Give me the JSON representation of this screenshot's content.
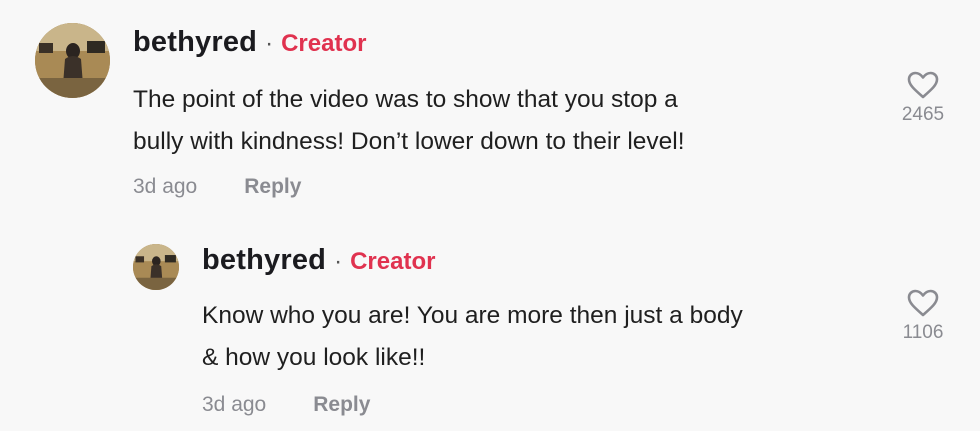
{
  "comments": [
    {
      "username": "bethyred",
      "separator": "·",
      "badge": "Creator",
      "text_lines": [
        "The point of the video was to show that you stop a",
        "bully with kindness! Don’t lower down to their level!"
      ],
      "time": "3d ago",
      "reply_label": "Reply",
      "like_count": "2465"
    },
    {
      "username": "bethyred",
      "separator": "·",
      "badge": "Creator",
      "text_lines": [
        "Know who you are! You are more then just a body",
        "& how you look like!!"
      ],
      "time": "3d ago",
      "reply_label": "Reply",
      "like_count": "1106"
    }
  ],
  "icons": {
    "like": "heart-outline-icon",
    "avatar": "user-avatar"
  },
  "colors": {
    "background": "#f8f8f8",
    "creator_badge": "#e0324f",
    "muted": "#8a8b91"
  }
}
